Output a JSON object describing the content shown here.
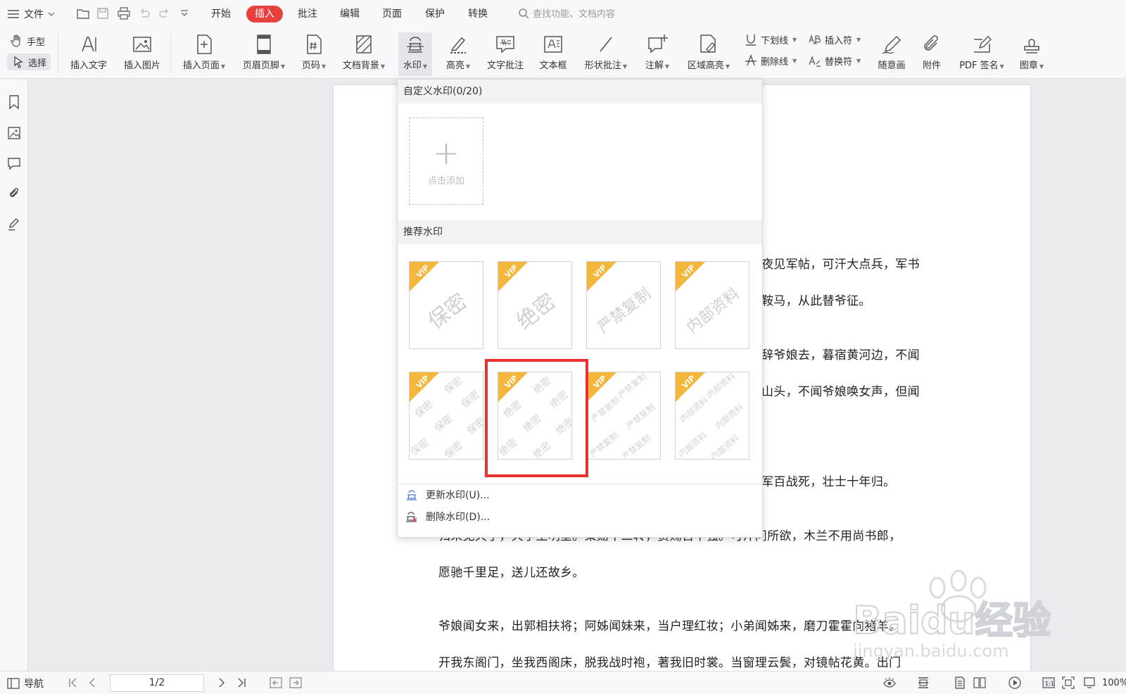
{
  "menubar": {
    "file_label": "文件",
    "tabs": [
      "开始",
      "插入",
      "批注",
      "编辑",
      "页面",
      "保护",
      "转换"
    ],
    "active_tab": "插入",
    "search_placeholder": "查找功能、文档内容"
  },
  "toolbar": {
    "hand_label": "手型",
    "select_label": "选择",
    "insert_text": "插入文字",
    "insert_image": "插入图片",
    "insert_page": "插入页面",
    "header_footer": "页眉页脚",
    "page_number": "页码",
    "doc_background": "文档背景",
    "watermark": "水印",
    "highlight": "高亮",
    "text_comment": "文字批注",
    "text_box": "文本框",
    "shape_comment": "形状批注",
    "annotation": "注解",
    "area_highlight": "区域高亮",
    "underline": "下划线",
    "strikethrough": "删除线",
    "insert_char": "插入符",
    "replace_char": "替换符",
    "freehand": "随意画",
    "attachment": "附件",
    "pdf_sign": "PDF 签名",
    "stamp": "图章"
  },
  "watermark_menu": {
    "custom_header": "自定义水印(0/20)",
    "add_label": "点击添加",
    "recommended_header": "推荐水印",
    "vip_label": "VIP",
    "big_items": [
      "保密",
      "绝密",
      "严禁复制",
      "内部资料"
    ],
    "tiled_items": [
      "保密",
      "绝密",
      "严禁复制",
      "内部资料"
    ],
    "update_action": "更新水印(U)...",
    "delete_action": "删除水印(D)..."
  },
  "document": {
    "lines": [
      "夜见军帖，可汗大点兵，军书",
      "鞍马，从此替爷征。",
      "辞爷娘去，暮宿黄河边，不闻",
      "山头，不闻爷娘唤女声，但闻",
      "军百战死，壮士十年归。",
      "归来见天子，天子坐明堂。策勋十二转，赏赐百千强。可汗问所欲，木兰不用尚书郎，",
      "愿驰千里足，送儿还故乡。",
      "爷娘闻女来，出郭相扶将；阿姊闻妹来，当户理红妆；小弟闻姊来，磨刀霍霍向猪羊。",
      "开我东阁门，坐我西阁床，脱我战时袍，著我旧时裳。当窗理云鬓，对镜帖花黄。出门"
    ]
  },
  "statusbar": {
    "nav_label": "导航",
    "page_indicator": "1/2",
    "zoom": "100%"
  },
  "brand_watermark": {
    "text": "Baidu经验",
    "url_text": "jingyan.baidu.com"
  },
  "colors": {
    "accent": "#e8413d",
    "highlight_box": "#e8322e",
    "vip_badge": "#f5b73b"
  }
}
